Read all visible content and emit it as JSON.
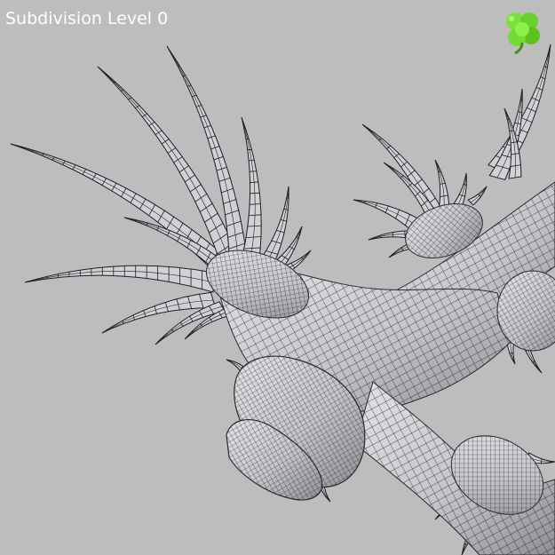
{
  "viewport": {
    "subdivision_label": "Subdivision Level 0",
    "logo_icon": "green-clover-logo",
    "background_color": "#bdbdbd",
    "mesh_fill_color": "#d4d4d8",
    "mesh_shade_color": "#8e8e96",
    "wireframe_color": "#1e1e24"
  }
}
